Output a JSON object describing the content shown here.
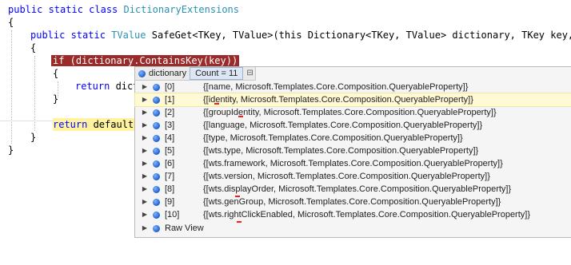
{
  "code": {
    "lines": [
      {
        "kw": "public static class ",
        "ty": "DictionaryExtensions"
      },
      {
        "text": "{"
      },
      {
        "kw": "public static ",
        "ty": "TValue",
        "rest": " SafeGet<TKey, TValue>(this Dictionary<TKey, TValue> dictionary, TKey key, TV"
      },
      {
        "text": "{"
      },
      {
        "text": "if (dictionary.ContainsKey(key))"
      },
      {
        "text": "{"
      },
      {
        "kw": "return ",
        "rest": "dict"
      },
      {
        "text": "}"
      },
      {
        "kw": "return ",
        "rest": "defaultR"
      },
      {
        "text": "}"
      },
      {
        "text": "}"
      }
    ]
  },
  "tooltip": {
    "name": "dictionary",
    "count": "Count = 11",
    "rows": [
      {
        "index": "[0]",
        "value": "{[name, Microsoft.Templates.Core.Composition.QueryableProperty]}"
      },
      {
        "index": "[1]",
        "value": "{[identity, Microsoft.Templates.Core.Composition.QueryableProperty]}"
      },
      {
        "index": "[2]",
        "value": "{[groupIdentity, Microsoft.Templates.Core.Composition.QueryableProperty]}"
      },
      {
        "index": "[3]",
        "value": "{[language, Microsoft.Templates.Core.Composition.QueryableProperty]}"
      },
      {
        "index": "[4]",
        "value": "{[type, Microsoft.Templates.Core.Composition.QueryableProperty]}"
      },
      {
        "index": "[5]",
        "value": "{[wts.type, Microsoft.Templates.Core.Composition.QueryableProperty]}"
      },
      {
        "index": "[6]",
        "value": "{[wts.framework, Microsoft.Templates.Core.Composition.QueryableProperty]}"
      },
      {
        "index": "[7]",
        "value": "{[wts.version, Microsoft.Templates.Core.Composition.QueryableProperty]}"
      },
      {
        "index": "[8]",
        "value": "{[wts.displayOrder, Microsoft.Templates.Core.Composition.QueryableProperty]}"
      },
      {
        "index": "[9]",
        "value": "{[wts.genGroup, Microsoft.Templates.Core.Composition.QueryableProperty]}"
      },
      {
        "index": "[10]",
        "value": "{[wts.rightClickEnabled, Microsoft.Templates.Core.Composition.QueryableProperty]}"
      }
    ],
    "raw_view": "Raw View"
  }
}
